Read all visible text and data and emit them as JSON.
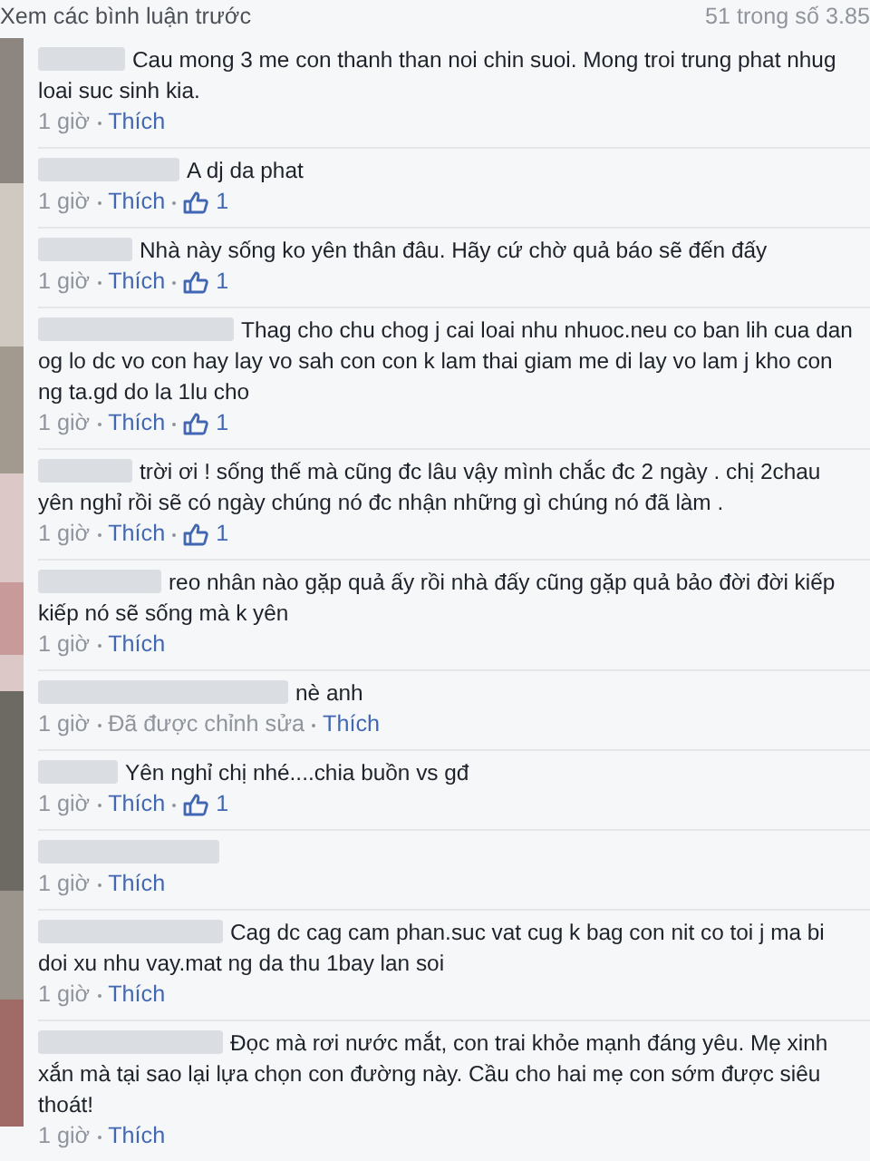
{
  "header": {
    "more_link": "Xem các bình luận trước",
    "count": "51 trong số 3.85"
  },
  "comments": [
    {
      "text": "Cau mong 3 me con thanh than noi chin suoi. Mong troi trung phat nhug loai suc sinh kia.",
      "time": "1 giờ",
      "like_label": "Thích"
    },
    {
      "text": "A dj da phat",
      "time": "1 giờ",
      "like_label": "Thích",
      "likes": "1"
    },
    {
      "text": "Nhà này sống ko yên thân đâu. Hãy cứ chờ quả báo sẽ đến đấy",
      "time": "1 giờ",
      "like_label": "Thích",
      "likes": "1"
    },
    {
      "text": "Thag cho chu chog j cai loai nhu nhuoc.neu co ban lih cua dan og lo dc vo con hay lay vo sah con con k lam thai giam me di lay vo lam j kho con ng ta.gd do la 1lu cho",
      "time": "1 giờ",
      "like_label": "Thích",
      "likes": "1"
    },
    {
      "text": "trời ơi ! sống thế mà cũng đc lâu vậy mình chắc đc 2 ngày . chị 2chau yên nghỉ rồi sẽ có ngày chúng nó đc nhận những gì chúng nó đã làm .",
      "time": "1 giờ",
      "like_label": "Thích",
      "likes": "1"
    },
    {
      "text": "reo nhân nào gặp quả ấy rồi nhà đấy cũng gặp quả bảo đời đời kiếp kiếp nó sẽ sống mà k yên",
      "time": "1 giờ",
      "like_label": "Thích"
    },
    {
      "text": "nè anh",
      "time": "1 giờ",
      "edited": "Đã được chỉnh sửa",
      "like_label": "Thích"
    },
    {
      "text": "Yên nghỉ chị nhé....chia buồn vs gđ",
      "time": "1 giờ",
      "like_label": "Thích",
      "likes": "1"
    },
    {
      "time": "1 giờ",
      "like_label": "Thích"
    },
    {
      "text": "Cag dc cag cam phan.suc vat cug k bag con nit co toi j ma bi doi xu nhu vay.mat ng da thu 1bay lan soi",
      "time": "1 giờ",
      "like_label": "Thích"
    },
    {
      "text": "Đọc mà rơi nước mắt, con trai khỏe mạnh đáng yêu. Mẹ xinh xắn mà tại sao lại lựa chọn con đường này. Cầu cho hai mẹ con sớm được siêu thoát!",
      "time": "1 giờ",
      "like_label": "Thích"
    }
  ]
}
